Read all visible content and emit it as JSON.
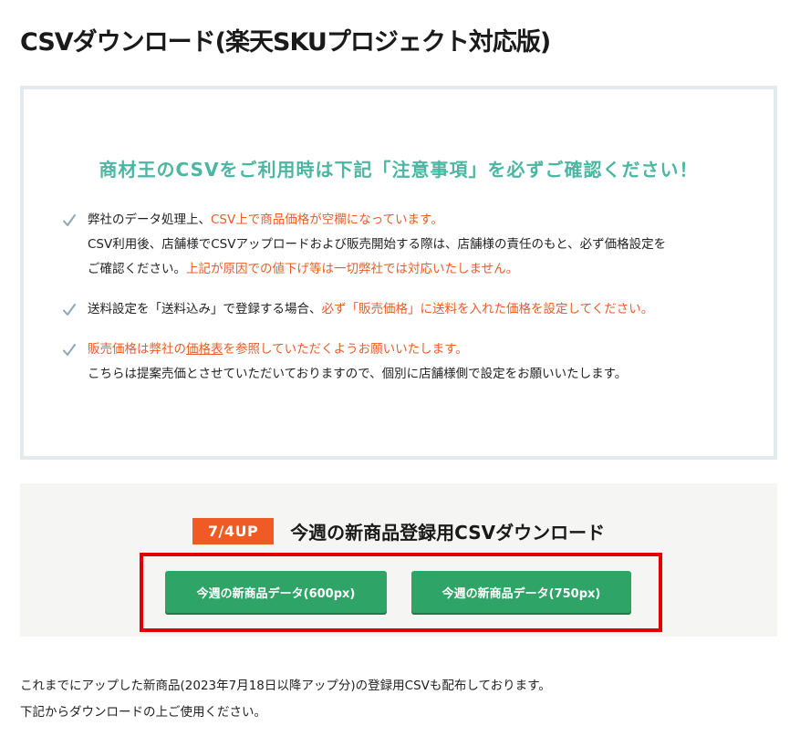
{
  "page": {
    "title": "CSVダウンロード(楽天SKUプロジェクト対応版)"
  },
  "notice": {
    "heading": "商材王のCSVをご利用時は下記「注意事項」を必ずご確認ください！",
    "items": [
      {
        "line1_a": "弊社のデータ処理上、",
        "line1_warn": "CSV上で商品価格が空欄になっています。",
        "line2": "CSV利用後、店舗様でCSVアップロードおよび販売開始する際は、店舗様の責任のもと、必ず価格設定を",
        "line3_a": "ご確認ください。",
        "line3_warn": "上記が原因での値下げ等は一切弊社では対応いたしません。"
      },
      {
        "line1_a": "送料設定を「送料込み」で登録する場合、",
        "line1_warn": "必ず「販売価格」に送料を入れた価格を設定してください。"
      },
      {
        "line1_warn_a": "販売価格は弊社の",
        "line1_link": "価格表",
        "line1_warn_b": "を参照していただくようお願いいたします。",
        "line2": "こちらは提案売価とさせていただいておりますので、個別に店舗様側で設定をお願いいたします。"
      }
    ],
    "icon": "check-icon",
    "colors": {
      "heading": "#4bb6a1",
      "warning": "#e85d2a",
      "check": "#8aa6bf"
    }
  },
  "download": {
    "badge": "7/4UP",
    "title": "今週の新商品登録用CSVダウンロード",
    "buttons": [
      {
        "label": "今週の新商品データ(600px)"
      },
      {
        "label": "今週の新商品データ(750px)"
      }
    ],
    "colors": {
      "badge": "#f05a24",
      "button": "#2ea566",
      "highlight": "#e00000"
    }
  },
  "footer": {
    "line1": "これまでにアップした新商品(2023年7月18日以降アップ分)の登録用CSVも配布しております。",
    "line2": "下記からダウンロードの上ご使用ください。"
  }
}
